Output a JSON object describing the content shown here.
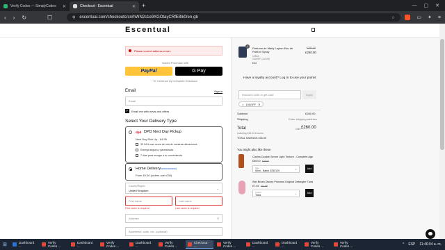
{
  "browser": {
    "tabs": [
      {
        "title": "Verify Codes — SimplyCodes",
        "active": false,
        "favicon_color": "#2bb673"
      },
      {
        "title": "Checkout - Escentual",
        "active": true,
        "favicon_color": "#dddddd"
      }
    ],
    "url": "escentual.com/checkouts/cn/hWN2c1e9XGOtayCRfE8lk0/en-gb"
  },
  "header": {
    "logo": "Escentual"
  },
  "checkout": {
    "error_text": "Please correct address errors",
    "express_label": "Instant Purchase with",
    "paypal_label": "PayPal",
    "gpay_label": "G Pay",
    "or_text": "Or Continue by Complete Checkout",
    "email_label": "Email",
    "signin_label": "Sign in",
    "email_placeholder": "Email",
    "newsletter_label": "Email me with news and offers",
    "delivery_heading": "Select Your Delivery Type",
    "dpd": {
      "logo": "dpd",
      "title": "DPD Next Day Pickup",
      "subtitle": "Next Day Pick Up - £4.95",
      "bullets": [
        "30 94% mas cerca de una de nuestras ubicaciones",
        "Entrega segura y garantizada",
        "7 días para recoger a tu conveniencia"
      ]
    },
    "home": {
      "title": "Home Delivery",
      "selected_label": "(seleccionado)",
      "subtitle": "From £0.00 (orders over £30)"
    },
    "country_label": "Country/Region",
    "country_value": "United Kingdom",
    "first_name_placeholder": "First name",
    "last_name_placeholder": "Last name",
    "first_name_error": "First name is required",
    "last_name_error": "Last name is required",
    "address_placeholder": "Address",
    "apt_placeholder": "Apartment, suite, etc. (optional)"
  },
  "summary": {
    "product": {
      "qty": "1",
      "name": "Parfums de Marly Layton Eau de Parfum Spray",
      "size": "125ml",
      "code": "100OFF (-£0.00)",
      "old_price": "£292.00",
      "price": "£260.00",
      "extra": "£44"
    },
    "loyalty_text": "Have a loyalty account? Log in to use your points",
    "discount_placeholder": "Discount code or gift card",
    "apply_label": "Apply",
    "chip_code": "100OFF",
    "subtotal_label": "Subtotal",
    "subtotal_value": "£260.00",
    "shipping_label": "Shipping",
    "shipping_value": "Enter shipping address",
    "total_label": "Total",
    "currency": "GBP",
    "total_value": "£260.00",
    "taxes_note": "Including £43.33 in taxes",
    "savings": "TOTAL SAVINGS £30.00",
    "recommend_heading": "You might also like these",
    "recs": [
      {
        "name": "Clarins Double Serum Light Texture - Complete Age",
        "price": "£65.00",
        "old": "£79.00",
        "select_label": "Size",
        "select_value": "50ml - Batch 0250120",
        "add": "Add",
        "color": "#b2501d"
      },
      {
        "name": "Wet Brush Disney Princess Original Detangler Tiara",
        "price": "£7.45",
        "old": "£14.99",
        "select_label": "Colour",
        "select_value": "Tiara",
        "add": "Add",
        "color": "#e8a2b5"
      }
    ]
  },
  "taskbar": {
    "items": [
      {
        "label": "Dashboard ...",
        "color": "#2a74d8"
      },
      {
        "label": "Verify Codes ...",
        "color": "#e04a3a"
      },
      {
        "label": "Dashboard ...",
        "color": "#e04a3a"
      },
      {
        "label": "Verify Codes ...",
        "color": "#e04a3a"
      },
      {
        "label": "Dashboard ...",
        "color": "#e04a3a"
      },
      {
        "label": "Verify Codes ...",
        "color": "#e04a3a"
      },
      {
        "label": "Checkout - ...",
        "color": "#e04a3a",
        "active": true
      },
      {
        "label": "Verify Codes ...",
        "color": "#e04a3a"
      },
      {
        "label": "Dashboard ...",
        "color": "#e04a3a"
      },
      {
        "label": "Dashboard ...",
        "color": "#e04a3a"
      },
      {
        "label": "Verify Codes ...",
        "color": "#e04a3a"
      },
      {
        "label": "Verify Codes ...",
        "color": "#e04a3a"
      }
    ],
    "lang": "ESP",
    "clock": "11:46:04 a. m."
  }
}
